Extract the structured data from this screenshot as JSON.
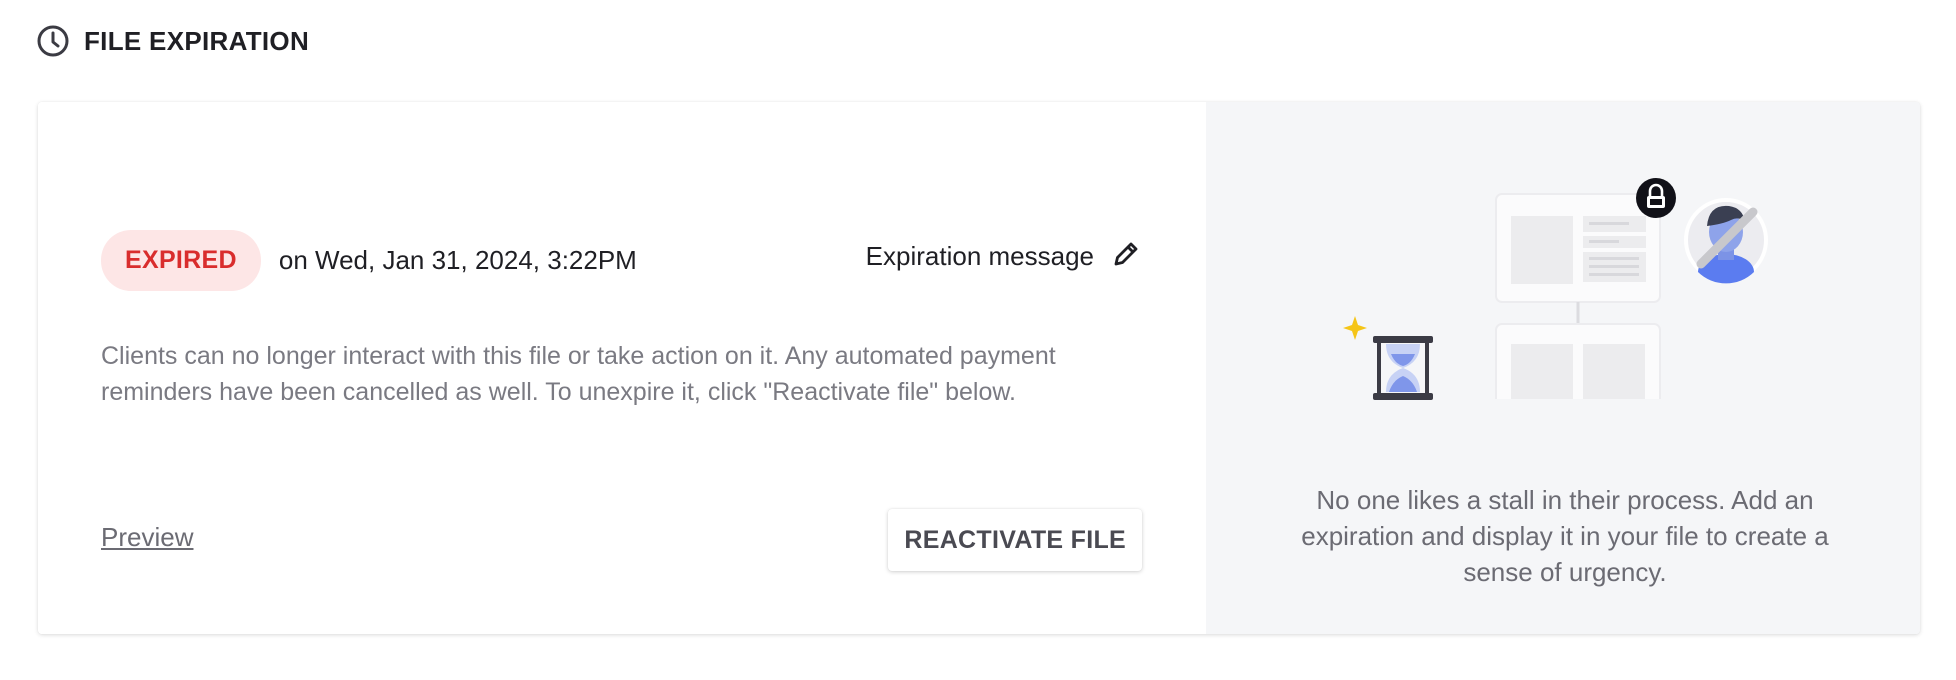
{
  "section": {
    "title": "FILE EXPIRATION",
    "icon": "clock-icon"
  },
  "status": {
    "badge": "EXPIRED",
    "date_text": "on Wed, Jan 31, 2024, 3:22PM",
    "badge_bg": "#fde6e6",
    "badge_color": "#d92d2d"
  },
  "expiration_message": {
    "label": "Expiration message",
    "icon": "pencil-icon"
  },
  "description": "Clients can no longer interact with this file or take action on it. Any automated payment reminders have been cancelled as well. To unexpire it, click \"Reactivate file\" below.",
  "actions": {
    "preview_label": "Preview",
    "reactivate_label": "REACTIVATE FILE"
  },
  "promo": {
    "text": "No one likes a stall in their process. Add an expiration and display it in your file to create a sense of urgency.",
    "illustration_icons": [
      "lock-icon",
      "avatar-icon",
      "hourglass-icon",
      "sparkle-icon",
      "document-icon"
    ]
  }
}
